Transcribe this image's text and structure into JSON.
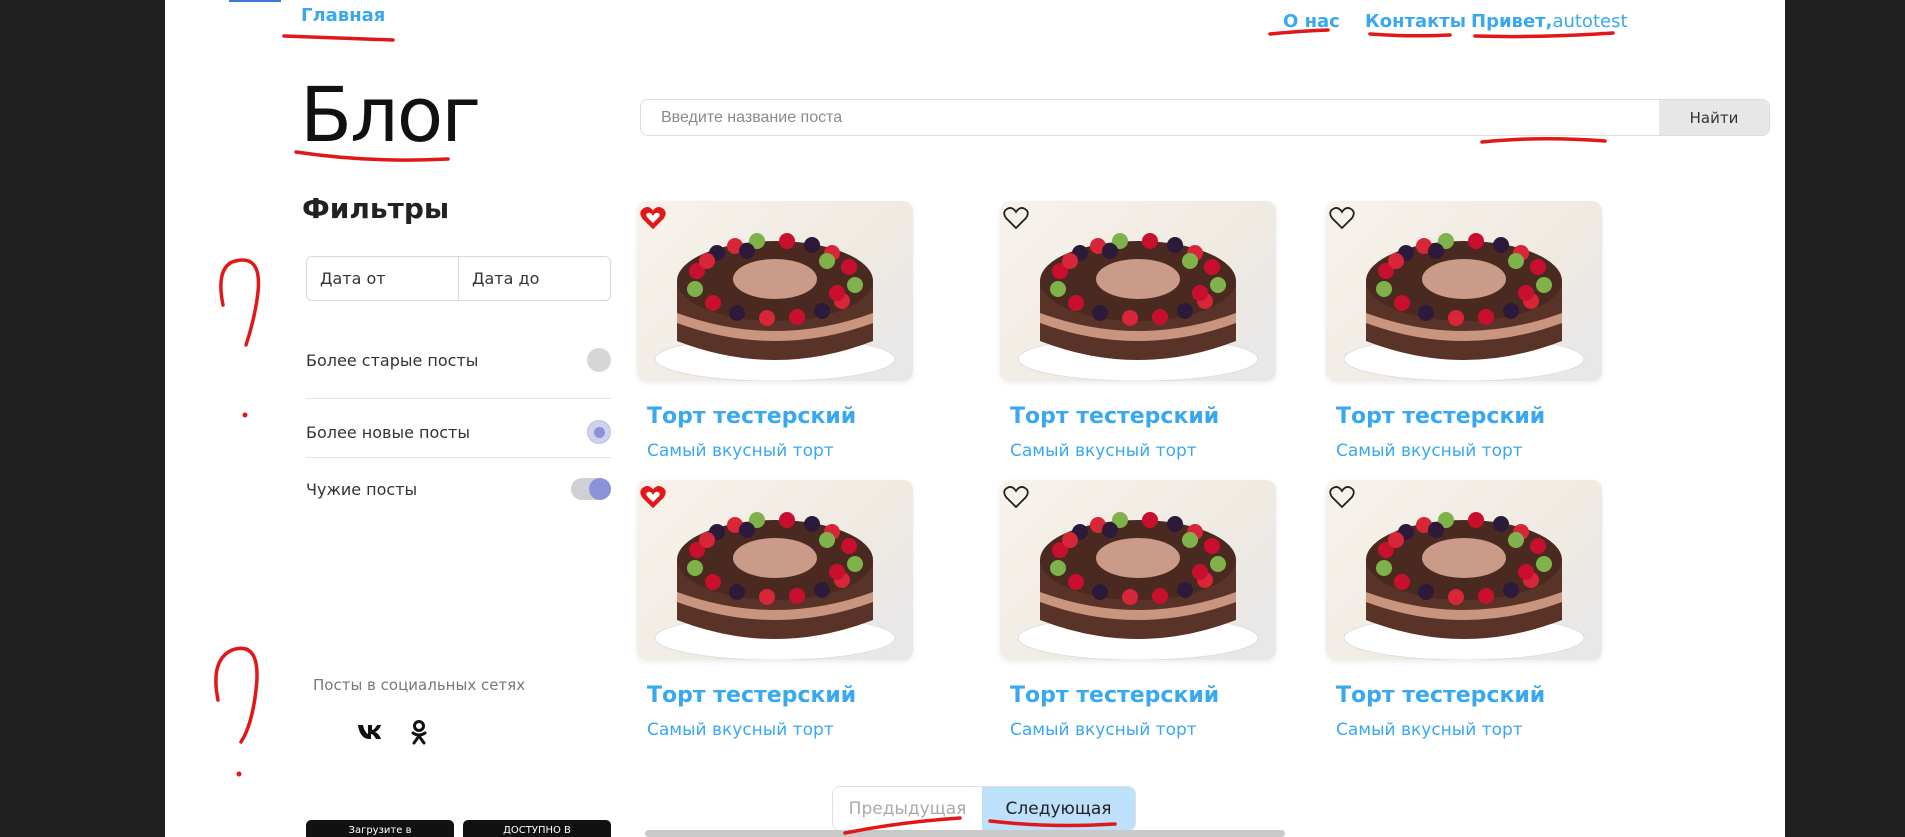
{
  "nav": {
    "home": "Главная",
    "about": "О нас",
    "contacts": "Контакты",
    "greeting": "Привет,",
    "username": "autotest"
  },
  "blog": {
    "title": "Блог"
  },
  "search": {
    "placeholder": "Введите название поста",
    "button": "Найти"
  },
  "filters": {
    "title": "Фильтры",
    "date_from": "Дата от",
    "date_to": "Дата до",
    "options": [
      {
        "label": "Более старые посты",
        "state": "off"
      },
      {
        "label": "Более новые посты",
        "state": "on"
      },
      {
        "label": "Чужие посты",
        "state": "on"
      }
    ]
  },
  "social": {
    "title": "Посты в социальных сетях",
    "icons": [
      "vk-icon",
      "odnoklassniki-icon"
    ]
  },
  "stores": {
    "apple": "Загрузите в",
    "google": "ДОСТУПНО В"
  },
  "posts": [
    {
      "title": "Торт тестерский",
      "subtitle": "Самый вкусный торт",
      "liked": true
    },
    {
      "title": "Торт тестерский",
      "subtitle": "Самый вкусный торт",
      "liked": false
    },
    {
      "title": "Торт тестерский",
      "subtitle": "Самый вкусный торт",
      "liked": false
    },
    {
      "title": "Торт тестерский",
      "subtitle": "Самый вкусный торт",
      "liked": true
    },
    {
      "title": "Торт тестерский",
      "subtitle": "Самый вкусный торт",
      "liked": false
    },
    {
      "title": "Торт тестерский",
      "subtitle": "Самый вкусный торт",
      "liked": false
    }
  ],
  "pagination": {
    "prev": "Предыдущая",
    "next": "Следующая"
  },
  "colors": {
    "accent": "#39a8ef",
    "annotation": "#e01818",
    "liked": "#e01818"
  }
}
